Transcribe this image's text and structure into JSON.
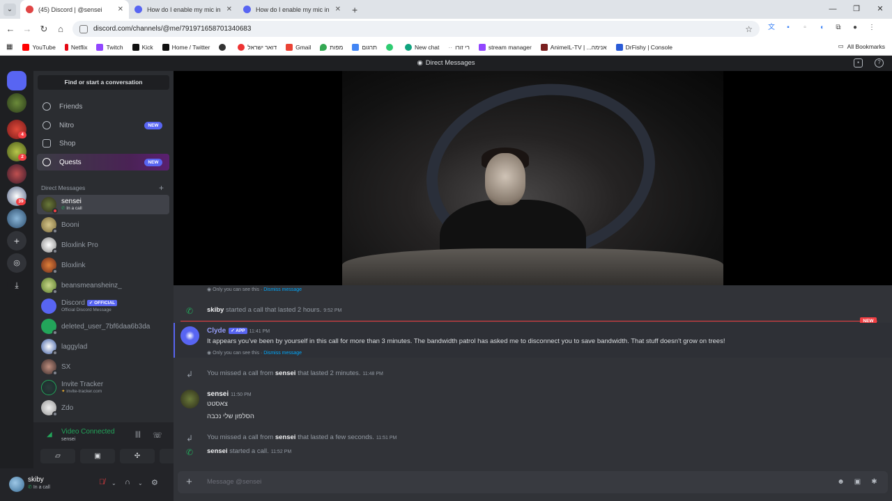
{
  "browser": {
    "tabs": [
      {
        "label": "(45) Discord | @sensei"
      },
      {
        "label": "How do I enable my mic in Chr"
      },
      {
        "label": "How do I enable my mic in Chr"
      }
    ],
    "url": "discord.com/channels/@me/791971658701340683",
    "bookmarks": [
      "YouTube",
      "Netflix",
      "Twitch",
      "Kick",
      "Home / Twitter",
      "דואר ישראל",
      "Gmail",
      "מפות",
      "תרגום",
      "New chat",
      "רי זורו",
      "stream manager",
      "AnimeIL-TV | ...אנימה",
      "DrFishy | Console"
    ],
    "all_bookmarks": "All Bookmarks"
  },
  "discord": {
    "header_title": "Direct Messages",
    "find_placeholder": "Find or start a conversation",
    "nav": [
      {
        "label": "Friends",
        "badge": ""
      },
      {
        "label": "Nitro",
        "badge": "NEW"
      },
      {
        "label": "Shop",
        "badge": ""
      },
      {
        "label": "Quests",
        "badge": "NEW"
      }
    ],
    "dm_header": "Direct Messages",
    "server_badges": [
      "4",
      "2",
      "39"
    ],
    "dms": [
      {
        "name": "sensei",
        "sub": "In a call"
      },
      {
        "name": "Booni",
        "sub": ""
      },
      {
        "name": "Bloxlink Pro",
        "sub": ""
      },
      {
        "name": "Bloxlink",
        "sub": ""
      },
      {
        "name": "beansmeansheinz_",
        "sub": ""
      },
      {
        "name": "Discord",
        "sub": "Official Discord Message",
        "tag": "OFFICIAL"
      },
      {
        "name": "deleted_user_7bf6daa6b3da",
        "sub": ""
      },
      {
        "name": "laggylad",
        "sub": ""
      },
      {
        "name": "SX",
        "sub": ""
      },
      {
        "name": "Invite Tracker",
        "sub": "invite-tracker.com"
      },
      {
        "name": "Zdo",
        "sub": ""
      }
    ],
    "voice": {
      "title": "Video Connected",
      "sub": "sensei"
    },
    "user": {
      "name": "skiby",
      "status": "In a call"
    },
    "messages": {
      "ephemeral_1": "Only you can see this",
      "dismiss": "Dismiss message",
      "call1_user": "skiby",
      "call1_text": "started a call that lasted 2 hours.",
      "call1_time": "9:52 PM",
      "new_tag": "NEW",
      "clyde_name": "Clyde",
      "clyde_badge": "APP",
      "clyde_time": "11:41 PM",
      "clyde_text": "It appears you've been by yourself in this call for more than 3 minutes. The bandwidth patrol has asked me to disconnect you to save bandwidth. That stuff doesn't grow on trees!",
      "ephemeral_2": "Only you can see this",
      "missed1_pre": "You missed a call from",
      "missed1_user": "sensei",
      "missed1_post": "that lasted 2 minutes.",
      "missed1_time": "11:48 PM",
      "sensei_name": "sensei",
      "sensei_time": "11:50 PM",
      "sensei_line1": "צאסטט",
      "sensei_line2": "הסלפון שלי נכבה",
      "missed2_pre": "You missed a call from",
      "missed2_user": "sensei",
      "missed2_post": "that lasted a few seconds.",
      "missed2_time": "11:51 PM",
      "call2_user": "sensei",
      "call2_text": "started a call.",
      "call2_time": "11:52 PM"
    },
    "composer_placeholder": "Message @sensei"
  }
}
